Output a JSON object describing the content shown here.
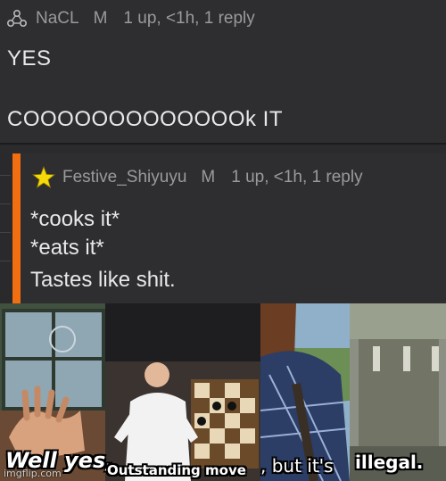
{
  "comment1": {
    "username": "NaCL",
    "badge": "M",
    "meta": "1 up, <1h, 1 reply",
    "lines": [
      "YES",
      "COOOOOOOOOOOOOk IT"
    ]
  },
  "comment2": {
    "username": "Festive_Shiyuyu",
    "badge": "M",
    "meta": "1 up, <1h, 1 reply",
    "lines": [
      "*cooks it*",
      "*eats it*",
      "Tastes like shit."
    ],
    "accent_color": "#f26f11"
  },
  "meme": {
    "captions": [
      "Well yes,",
      "Outstanding move",
      ", but it's",
      "illegal."
    ],
    "watermark": "imgflip.com"
  },
  "icons": {
    "user1": "molecule-icon",
    "user2": "star-icon"
  }
}
